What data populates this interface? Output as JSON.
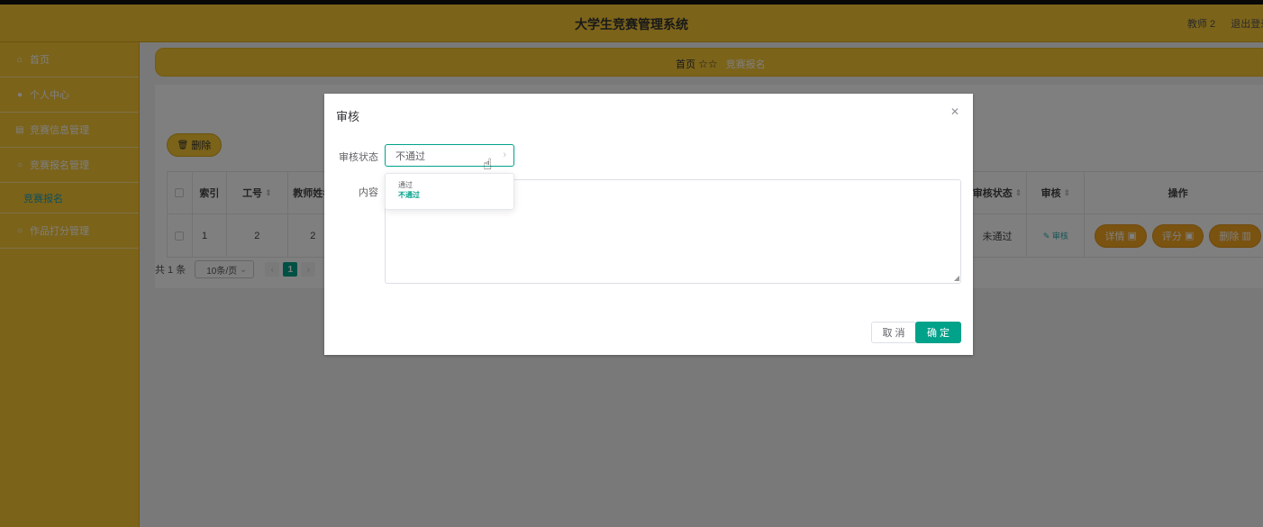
{
  "header": {
    "title": "大学生竞赛管理系统",
    "user": "教师 2",
    "logout": "退出登录"
  },
  "sidebar": {
    "items": [
      {
        "label": "首页",
        "icon": "home-icon"
      },
      {
        "label": "个人中心",
        "icon": "user-icon"
      },
      {
        "label": "竞赛信息管理",
        "icon": "folder-icon"
      },
      {
        "label": "竞赛报名管理",
        "icon": "form-icon"
      },
      {
        "label": "竞赛报名",
        "sub": true
      },
      {
        "label": "作品打分管理",
        "icon": "star-icon"
      }
    ]
  },
  "breadcrumb": {
    "home": "首页",
    "stars": "☆☆",
    "current": "竞赛报名"
  },
  "toolbar": {
    "delete_label": "删除"
  },
  "table": {
    "headers": {
      "index": "索引",
      "job_no": "工号",
      "teacher_name": "教师姓名",
      "audit_status": "审核状态",
      "audit": "审核",
      "actions": "操作"
    },
    "rows": [
      {
        "index": "1",
        "job_no": "2",
        "teacher_name": "2",
        "audit_status": "未通过",
        "audit_link": "审核"
      }
    ],
    "row_actions": {
      "detail": "详情",
      "score": "评分",
      "delete": "删除"
    }
  },
  "pager": {
    "total": "共 1 条",
    "page_size": "10条/页",
    "current_page": "1"
  },
  "dialog": {
    "title": "审核",
    "status_label": "审核状态",
    "status_value": "不通过",
    "status_options": [
      "通过",
      "不通过"
    ],
    "content_label": "内容",
    "cancel_label": "取 消",
    "ok_label": "确 定"
  }
}
